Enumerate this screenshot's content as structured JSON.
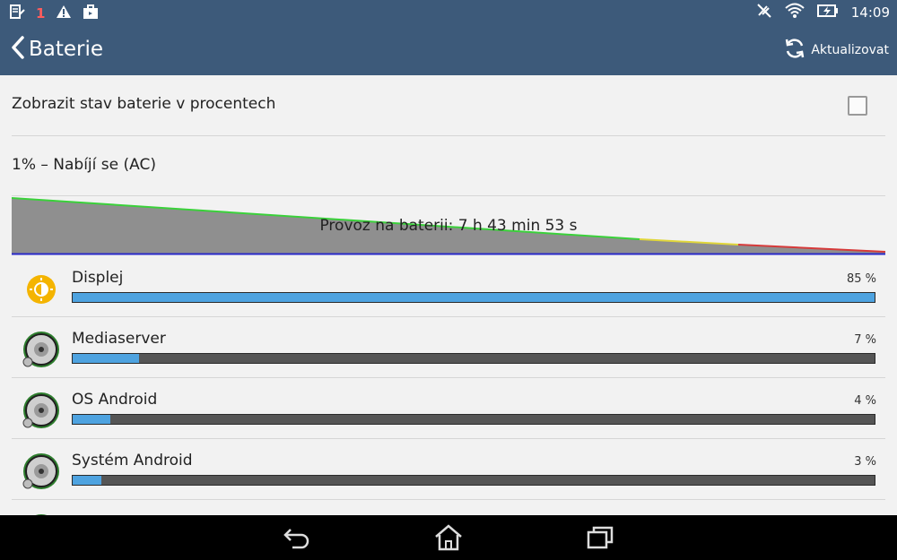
{
  "status_bar": {
    "notification_count": "1",
    "time": "14:09",
    "icons": [
      "notes-icon",
      "warning-icon",
      "briefcase-icon",
      "muted-icon",
      "wifi-icon",
      "battery-charging-icon"
    ]
  },
  "action_bar": {
    "title": "Baterie",
    "refresh_label": "Aktualizovat"
  },
  "settings": {
    "show_percent_label": "Zobrazit stav baterie v procentech",
    "show_percent_checked": false
  },
  "battery": {
    "status": "1% – Nabíjí se (AC)",
    "graph_label": "Provoz na baterii: 7 h 43 min 53 s"
  },
  "usage": [
    {
      "name": "Displej",
      "percent_label": "85 %",
      "percent": 85,
      "icon": "display-brightness-icon"
    },
    {
      "name": "Mediaserver",
      "percent_label": "7 %",
      "percent": 7,
      "icon": "android-app-icon"
    },
    {
      "name": "OS Android",
      "percent_label": "4 %",
      "percent": 4,
      "icon": "android-app-icon"
    },
    {
      "name": "Systém Android",
      "percent_label": "3 %",
      "percent": 3,
      "icon": "android-app-icon"
    }
  ],
  "colors": {
    "accent_bar": "#4ea3e0",
    "header": "#3d5a7a"
  }
}
